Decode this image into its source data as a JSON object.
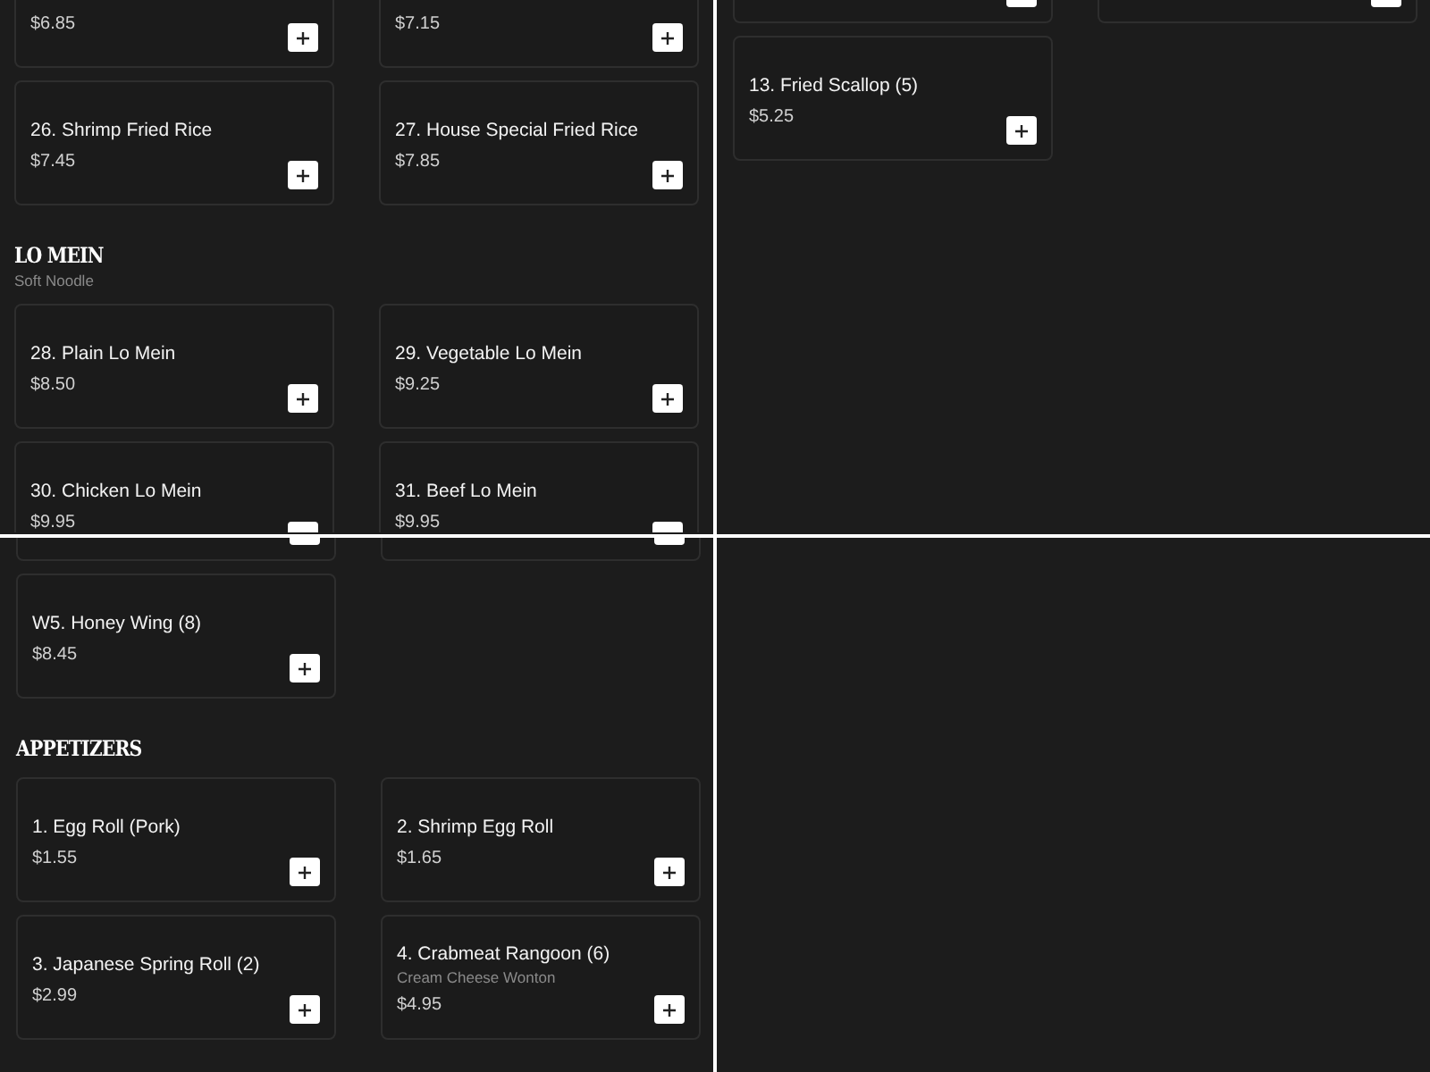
{
  "panels": [
    {
      "kind": "menu",
      "blocks": [
        {
          "kind": "tail",
          "items": [
            {
              "kind": "dish",
              "price": "$6.85"
            },
            {
              "kind": "dish",
              "price": "$7.15"
            }
          ]
        },
        {
          "kind": "row",
          "items": [
            {
              "kind": "dish",
              "name": "26. Shrimp Fried Rice",
              "price": "$7.45"
            },
            {
              "kind": "dish",
              "name": "27. House Special Fried Rice",
              "price": "$7.85"
            }
          ]
        },
        {
          "kind": "heading",
          "title": "LO MEIN",
          "subtitle": "Soft Noodle"
        },
        {
          "kind": "row",
          "items": [
            {
              "kind": "dish",
              "name": "28. Plain Lo Mein",
              "price": "$8.50"
            },
            {
              "kind": "dish",
              "name": "29. Vegetable Lo Mein",
              "price": "$9.25"
            }
          ]
        },
        {
          "kind": "head",
          "items": [
            {
              "kind": "dish",
              "name": "30. Chicken Lo Mein",
              "price": "$9.95"
            },
            {
              "kind": "dish",
              "name": "31. Beef Lo Mein",
              "price": "$9.95"
            }
          ]
        }
      ]
    },
    {
      "kind": "menu",
      "blocks": [
        {
          "kind": "edge",
          "items": [
            {
              "kind": "dish"
            },
            {
              "kind": "dish"
            }
          ]
        },
        {
          "kind": "row",
          "items": [
            {
              "kind": "dish",
              "name": "13. Fried Scallop (5)",
              "price": "$5.25"
            }
          ]
        }
      ]
    },
    {
      "kind": "menu",
      "blocks": [
        {
          "kind": "edge",
          "items": [
            {
              "kind": "dish"
            },
            {
              "kind": "dish"
            }
          ]
        },
        {
          "kind": "row",
          "items": [
            {
              "kind": "dish",
              "name": "W5. Honey Wing (8)",
              "price": "$8.45"
            }
          ]
        },
        {
          "kind": "heading",
          "title": "APPETIZERS"
        },
        {
          "kind": "row",
          "items": [
            {
              "kind": "dish",
              "name": "1. Egg Roll (Pork)",
              "price": "$1.55"
            },
            {
              "kind": "dish",
              "name": "2. Shrimp Egg Roll",
              "price": "$1.65"
            }
          ]
        },
        {
          "kind": "row",
          "items": [
            {
              "kind": "dish",
              "name": "3. Japanese Spring Roll (2)",
              "price": "$2.99"
            },
            {
              "kind": "dish",
              "name": "4. Crabmeat Rangoon (6)",
              "description": "Cream Cheese Wonton",
              "price": "$4.95"
            }
          ]
        }
      ]
    },
    {
      "kind": "empty"
    }
  ]
}
